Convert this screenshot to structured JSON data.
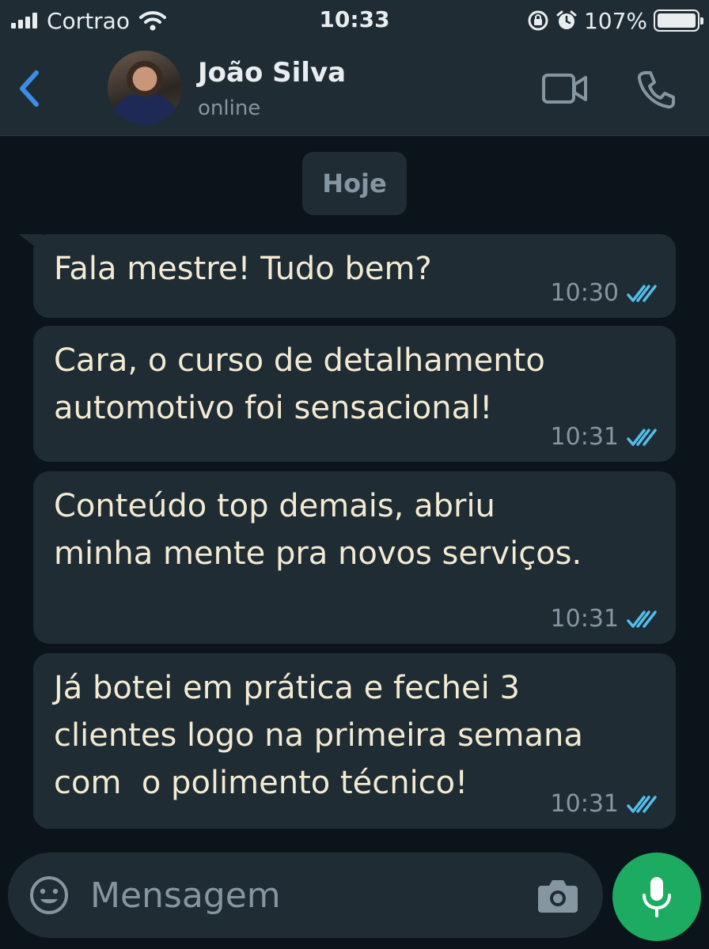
{
  "status_bar": {
    "carrier": "Cortrao",
    "time": "10:33",
    "battery": "107%",
    "icons": [
      "signal-icon",
      "wifi-icon",
      "rotation-lock-icon",
      "alarm-icon",
      "battery-icon"
    ]
  },
  "header": {
    "contact_name": "João Silva",
    "contact_status": "online",
    "icons": [
      "back-chevron-icon",
      "video-call-icon",
      "phone-icon"
    ]
  },
  "chat": {
    "date_chip": "Hoje",
    "messages": [
      {
        "text": "Fala mestre! Tudo bem?",
        "time": "10:30",
        "status": "read"
      },
      {
        "text": "Cara, o curso de detalhamento\nautomotivo foi sensacional!",
        "time": "10:31",
        "status": "read"
      },
      {
        "text": "Conteúdo top demais, abriu\nminha mente pra novos serviços.",
        "time": "10:31",
        "status": "read"
      },
      {
        "text": "Já botei em prática e fechei 3\nclientes logo na primeira semana\ncom  o polimento técnico!",
        "time": "10:31",
        "status": "read"
      }
    ]
  },
  "composer": {
    "placeholder": "Mensagem",
    "icons": [
      "emoji-icon",
      "camera-icon",
      "microphone-icon"
    ]
  },
  "colors": {
    "background": "#0b141a",
    "bar": "#1f2c34",
    "bubble": "#1f2c34",
    "message_text": "#f3ead2",
    "read_ticks": "#53bdeb",
    "back_accent": "#3b8ee8",
    "mic_button": "#1daa61"
  }
}
